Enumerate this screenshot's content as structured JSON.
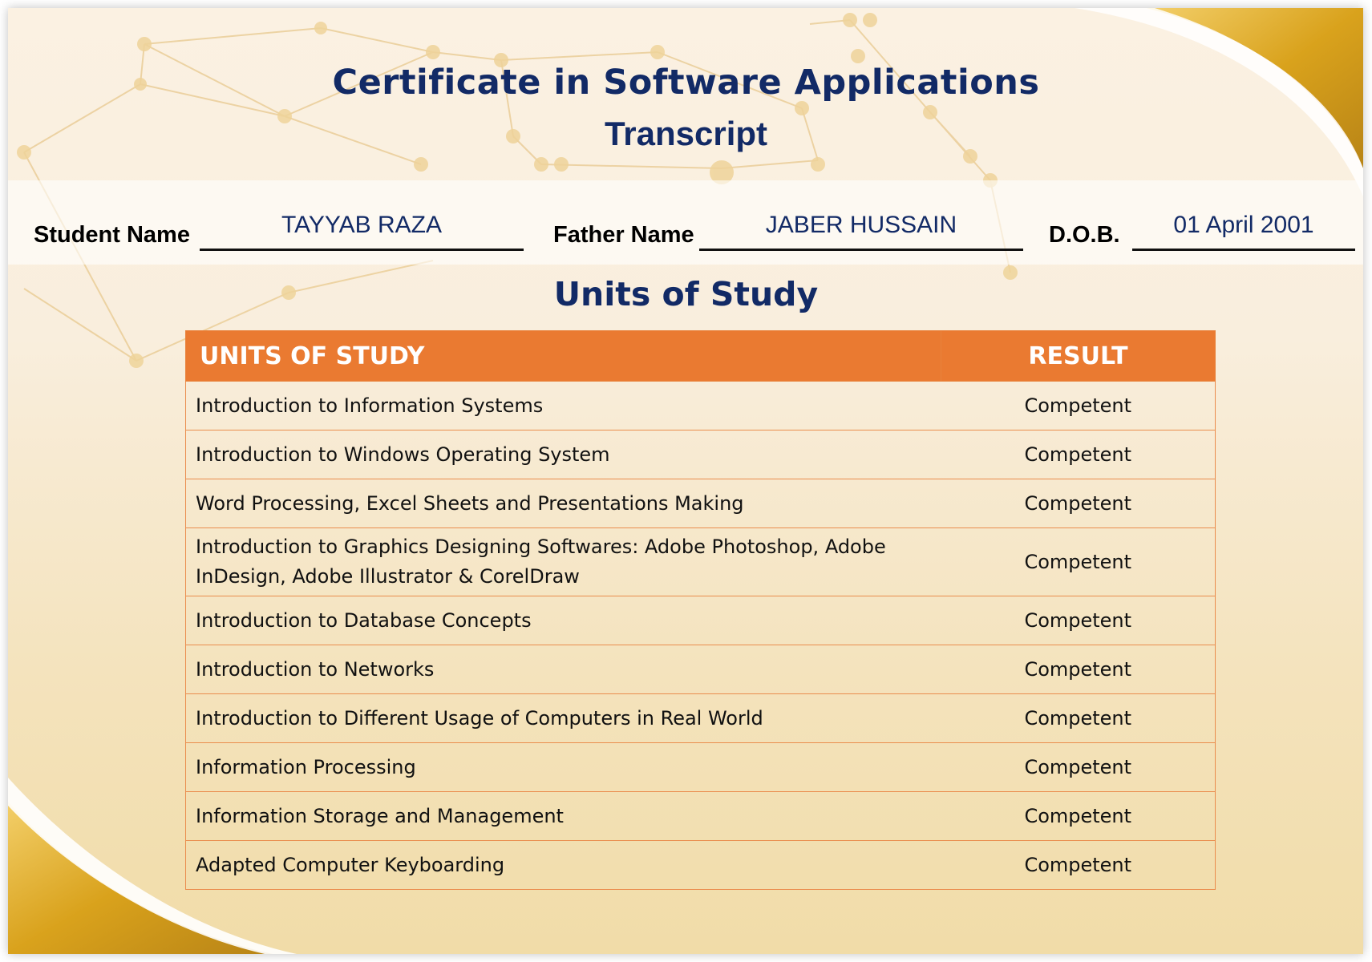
{
  "title": "Certificate in Software Applications",
  "subtitle": "Transcript",
  "student": {
    "name_label": "Student Name",
    "name_value": "TAYYAB RAZA",
    "father_label": "Father Name",
    "father_value": "JABER HUSSAIN",
    "dob_label": "D.O.B.",
    "dob_value": "01 April 2001"
  },
  "units_heading": "Units of Study",
  "table": {
    "headers": [
      "UNITS OF STUDY",
      "RESULT"
    ],
    "rows": [
      {
        "unit": "Introduction to Information Systems",
        "result": "Competent"
      },
      {
        "unit": "Introduction to Windows Operating System",
        "result": "Competent"
      },
      {
        "unit": "Word Processing, Excel Sheets and Presentations Making",
        "result": "Competent"
      },
      {
        "unit": "Introduction to Graphics Designing Softwares: Adobe Photoshop, Adobe InDesign, Adobe Illustrator & CorelDraw",
        "result": "Competent"
      },
      {
        "unit": "Introduction to Database Concepts",
        "result": "Competent"
      },
      {
        "unit": "Introduction to Networks",
        "result": "Competent"
      },
      {
        "unit": "Introduction to Different Usage of Computers in Real World",
        "result": "Competent"
      },
      {
        "unit": "Information Processing",
        "result": "Competent"
      },
      {
        "unit": "Information Storage and Management",
        "result": "Competent"
      },
      {
        "unit": "Adapted Computer Keyboarding",
        "result": "Competent"
      }
    ]
  },
  "colors": {
    "title": "#122a66",
    "header_bg": "#ea7a31",
    "gold_accent": "#d9a21c",
    "cream_bg": "#f9eedd"
  }
}
